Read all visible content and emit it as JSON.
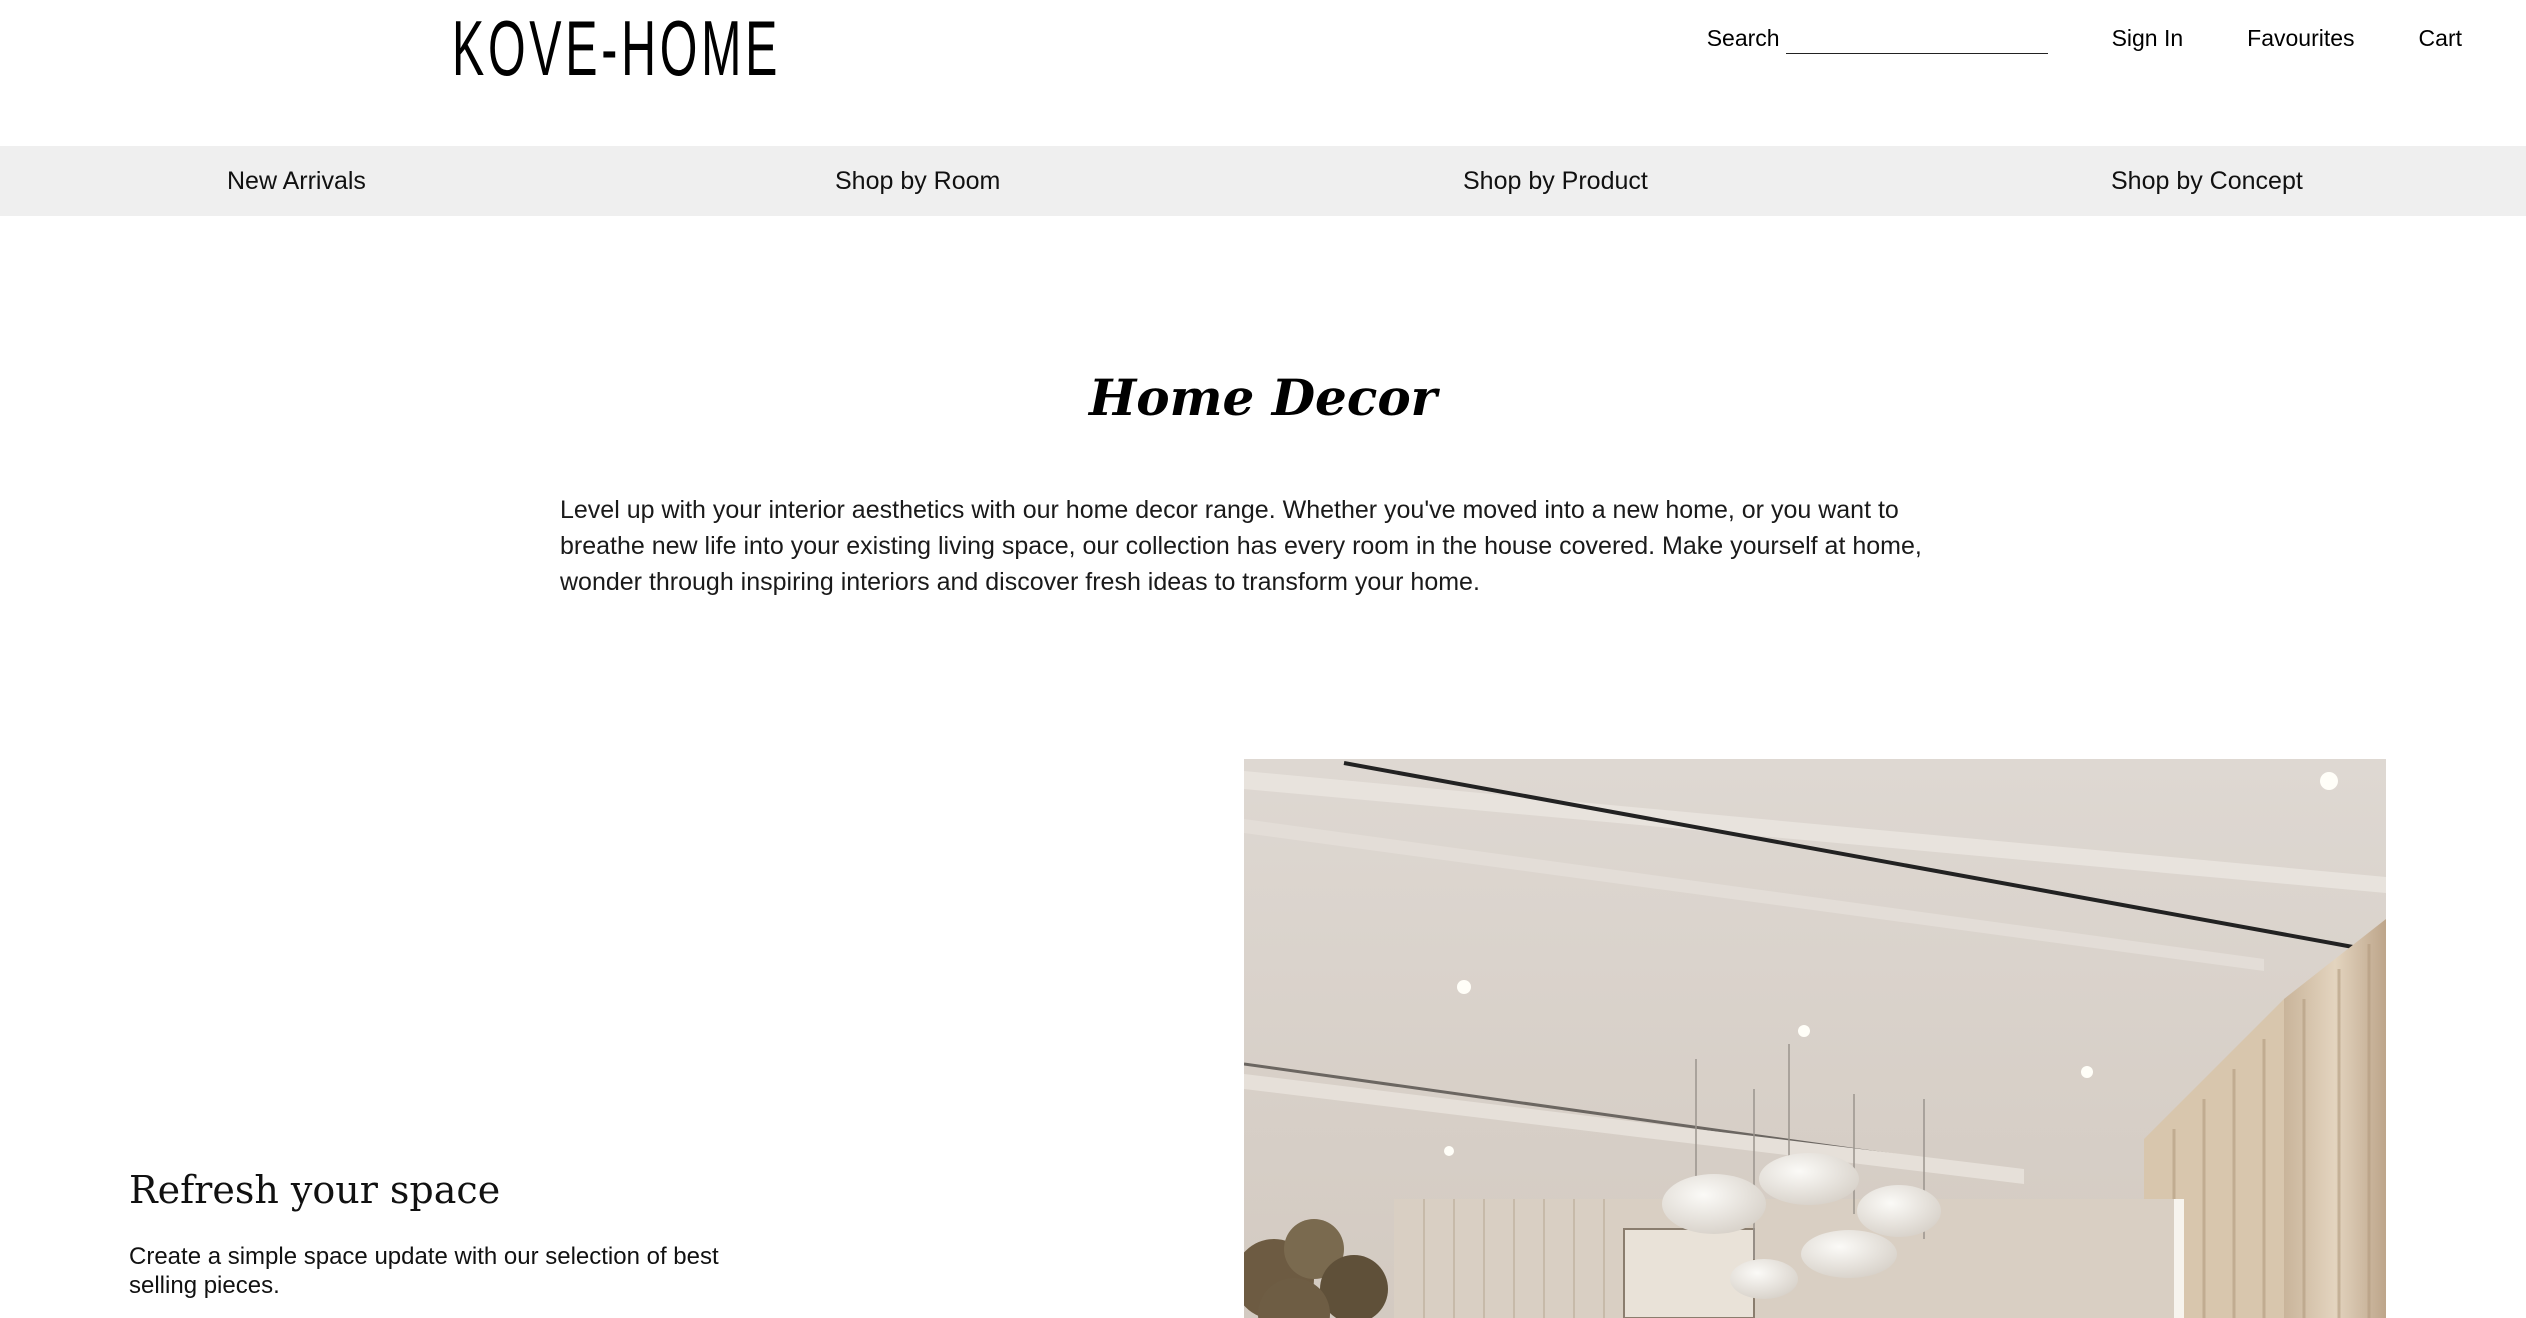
{
  "brand": {
    "logo_text": "KOVE-HOME"
  },
  "header": {
    "search_label": "Search",
    "search_value": "",
    "search_placeholder": "",
    "sign_in": "Sign In",
    "favourites": "Favourites",
    "cart": "Cart"
  },
  "nav": {
    "items": [
      {
        "label": "New Arrivals"
      },
      {
        "label": "Shop by Room"
      },
      {
        "label": "Shop by Product"
      },
      {
        "label": "Shop by Concept"
      }
    ]
  },
  "main": {
    "title": "Home Decor",
    "intro": "Level up with your interior aesthetics with our home decor range. Whether you've moved into a new home, or you want to breathe new life into your existing living space, our collection has every room in the house covered. Make yourself at home, wonder through inspiring interiors and discover fresh ideas to transform your home."
  },
  "promo": {
    "heading": "Refresh your space",
    "text": "Create a simple space update with our selection of best selling pieces.",
    "image_subject": "interior-with-pendant-lights"
  },
  "colors": {
    "nav_background": "#efefef",
    "page_background": "#ffffff",
    "text": "#111111"
  }
}
